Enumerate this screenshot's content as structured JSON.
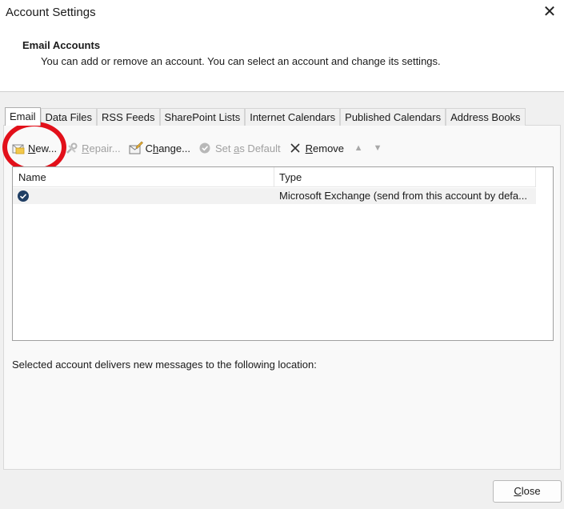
{
  "window": {
    "title": "Account Settings",
    "close_icon": "close-icon"
  },
  "header": {
    "title": "Email Accounts",
    "description": "You can add or remove an account. You can select an account and change its settings."
  },
  "tabs": [
    {
      "label": "Email",
      "active": true
    },
    {
      "label": "Data Files",
      "active": false
    },
    {
      "label": "RSS Feeds",
      "active": false
    },
    {
      "label": "SharePoint Lists",
      "active": false
    },
    {
      "label": "Internet Calendars",
      "active": false
    },
    {
      "label": "Published Calendars",
      "active": false
    },
    {
      "label": "Address Books",
      "active": false
    }
  ],
  "toolbar": {
    "new_label": "New...",
    "repair_label": "Repair...",
    "change_label": "Change...",
    "set_default_label": "Set as Default",
    "remove_label": "Remove",
    "move_up_icon": "arrow-up-icon",
    "move_down_icon": "arrow-down-icon"
  },
  "accounts_list": {
    "columns": [
      "Name",
      "Type"
    ],
    "rows": [
      {
        "name": "",
        "type": "Microsoft Exchange (send from this account by defa...",
        "default": true
      }
    ]
  },
  "deliver_label": "Selected account delivers new messages to the following location:",
  "footer": {
    "close_label": "Close"
  },
  "colors": {
    "callout": "#e2101a",
    "default_check": "#1f3e64"
  }
}
